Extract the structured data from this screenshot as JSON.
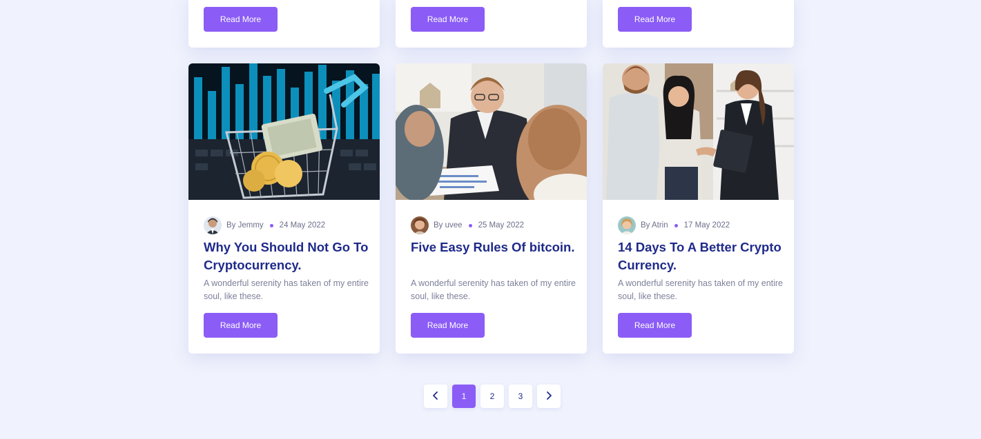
{
  "top_row": [
    {
      "read_more_label": "Read More"
    },
    {
      "read_more_label": "Read More"
    },
    {
      "read_more_label": "Read More"
    }
  ],
  "posts": [
    {
      "image_icon": "crypto-shopping-cart-image",
      "author": "By Jemmy",
      "date": "24 May 2022",
      "title": "Why You Should Not Go To Cryptocurrency.",
      "excerpt": "A wonderful serenity has taken of my entire soul, like these.",
      "read_more_label": "Read More"
    },
    {
      "image_icon": "business-meeting-image",
      "author": "By uvee",
      "date": "25 May 2022",
      "title": "Five Easy Rules Of bitcoin.",
      "excerpt": "A wonderful serenity has taken of my entire soul, like these.",
      "read_more_label": "Read More"
    },
    {
      "image_icon": "handshake-image",
      "author": "By Atrin",
      "date": "17 May 2022",
      "title": "14 Days To A Better Crypto Currency.",
      "excerpt": "A wonderful serenity has taken of my entire soul, like these.",
      "read_more_label": "Read More"
    }
  ],
  "pagination": {
    "prev_icon": "chevron-left-icon",
    "pages": [
      "1",
      "2",
      "3"
    ],
    "active_page": "1",
    "next_icon": "chevron-right-icon"
  },
  "colors": {
    "accent": "#8b5cf6",
    "title": "#1f2a8a",
    "background": "#f0f3fd"
  }
}
